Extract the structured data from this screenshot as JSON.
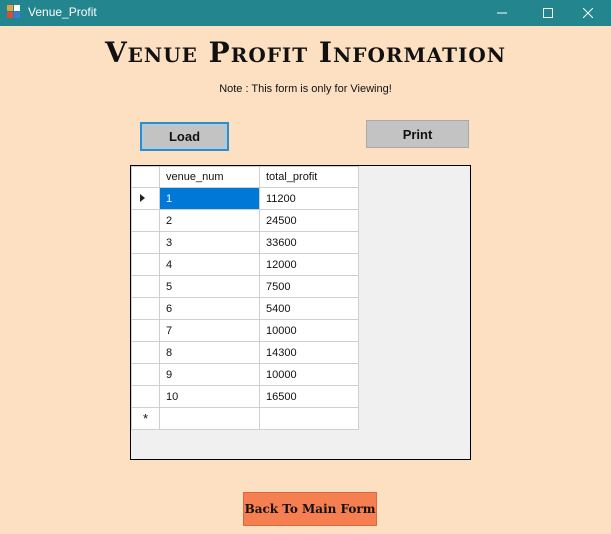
{
  "window": {
    "title": "Venue_Profit"
  },
  "heading": "Venue Profit Information",
  "note": "Note : This form is only for Viewing!",
  "buttons": {
    "load": "Load",
    "print": "Print",
    "back": "Back To Main Form"
  },
  "grid": {
    "columns": [
      "venue_num",
      "total_profit"
    ],
    "rows": [
      [
        "1",
        "11200"
      ],
      [
        "2",
        "24500"
      ],
      [
        "3",
        "33600"
      ],
      [
        "4",
        "12000"
      ],
      [
        "5",
        "7500"
      ],
      [
        "6",
        "5400"
      ],
      [
        "7",
        "10000"
      ],
      [
        "8",
        "14300"
      ],
      [
        "9",
        "10000"
      ],
      [
        "10",
        "16500"
      ]
    ],
    "new_row_marker": "*",
    "selected_row": 0
  },
  "icons": {
    "app": "app-icon",
    "minimize": "minimize-icon",
    "maximize": "maximize-icon",
    "close": "close-icon",
    "row_indicator": "current-row-arrow-icon"
  },
  "colors": {
    "titlebar": "#23858e",
    "form_bg": "#fde0c2",
    "selection": "#0078d7",
    "back_button": "#f57f50"
  }
}
